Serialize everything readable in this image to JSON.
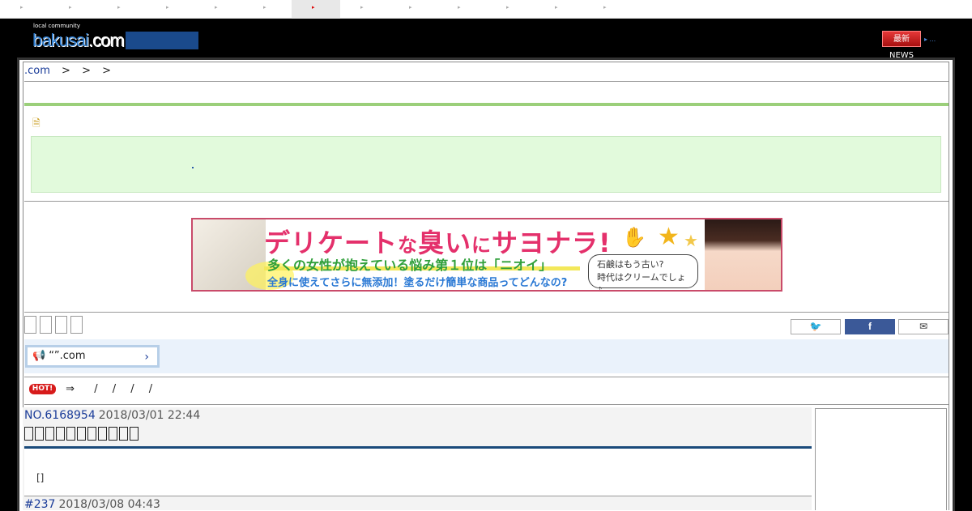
{
  "header": {
    "logo_small": "local community",
    "logo_main": "bakusai",
    "logo_suffix": ".com",
    "news_badge": "最新NEWS",
    "news_dots": "▸ ..."
  },
  "breadcrumb": {
    "home": ".com",
    "separators": [
      ">",
      ">",
      ">"
    ]
  },
  "ad": {
    "headline_part1": "デリケート",
    "headline_part2": "な",
    "headline_part3": "臭い",
    "headline_part4": "に",
    "headline_part5": "サヨナラ!",
    "sub1": "多くの女性が抱えている悩み第１位は「ニオイ」",
    "sub2": "全身に使えてさらに無添加！塗るだけ簡単な商品ってどんなの?",
    "bubble_line1": "石鹸はもう古い?",
    "bubble_line2": "時代はクリームでしょ♪"
  },
  "notice": {
    "text": "“”.com"
  },
  "hot": {
    "badge": "HOT!",
    "arrow": "⇒",
    "slashes": [
      "/",
      "/",
      "/",
      "/"
    ]
  },
  "post": {
    "number": "NO.6168954",
    "date": "2018/03/01 22:44",
    "body": "[]"
  },
  "reply": {
    "number": "#237",
    "date": "2018/03/08 04:43"
  },
  "colors": {
    "link": "#1a3c99",
    "green_bar": "#9bcf7a",
    "notice_band": "#eaf2fb",
    "facebook": "#3b5998",
    "twitter": "#1d9bf0",
    "hot": "#d71b1b"
  }
}
